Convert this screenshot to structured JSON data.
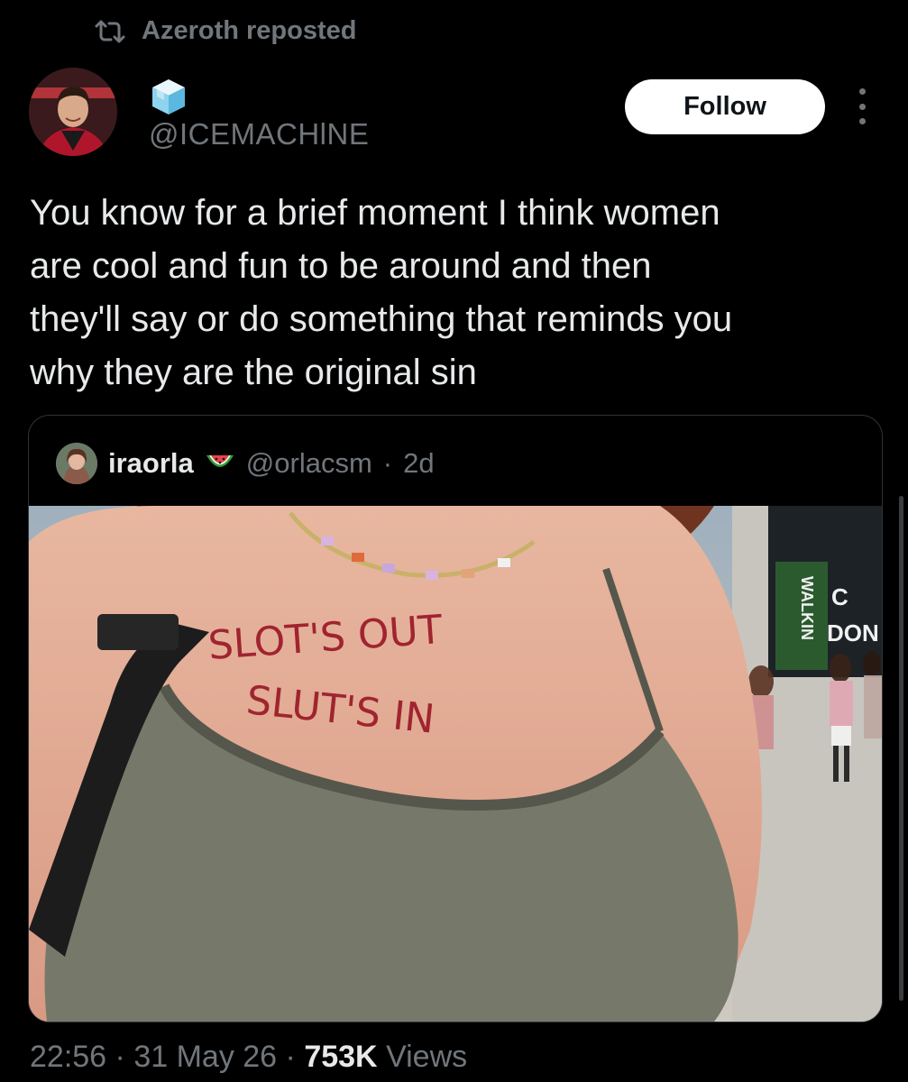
{
  "repost": {
    "label": "Azeroth reposted",
    "icon": "repost-icon"
  },
  "author": {
    "handle": "@ICEMACHlNE",
    "icon": "ice-cube-icon"
  },
  "follow_label": "Follow",
  "tweet": {
    "lines": [
      "You know for a brief moment I think women",
      "are cool and fun to be around and then",
      "they'll say or do something that reminds you",
      "why they are the original sin"
    ]
  },
  "quoted": {
    "name": "iraorla",
    "emoji": "watermelon-icon",
    "handle": "@orlacsm",
    "separator": "·",
    "age": "2d",
    "photo": {
      "written_text_1": "SLOT'S OUT",
      "written_text_2": "SLUT'S IN",
      "sign_text": "WALKIN",
      "sign_text_2": "C",
      "sign_text_3": "DON"
    }
  },
  "meta": {
    "time": "22:56",
    "sep1": "·",
    "date": "31 May 26",
    "sep2": "·",
    "views_count": "753K",
    "views_label": "Views"
  },
  "colors": {
    "background": "#000000",
    "muted": "#71767b",
    "text": "#e7e9ea",
    "button": "#ffffff"
  }
}
